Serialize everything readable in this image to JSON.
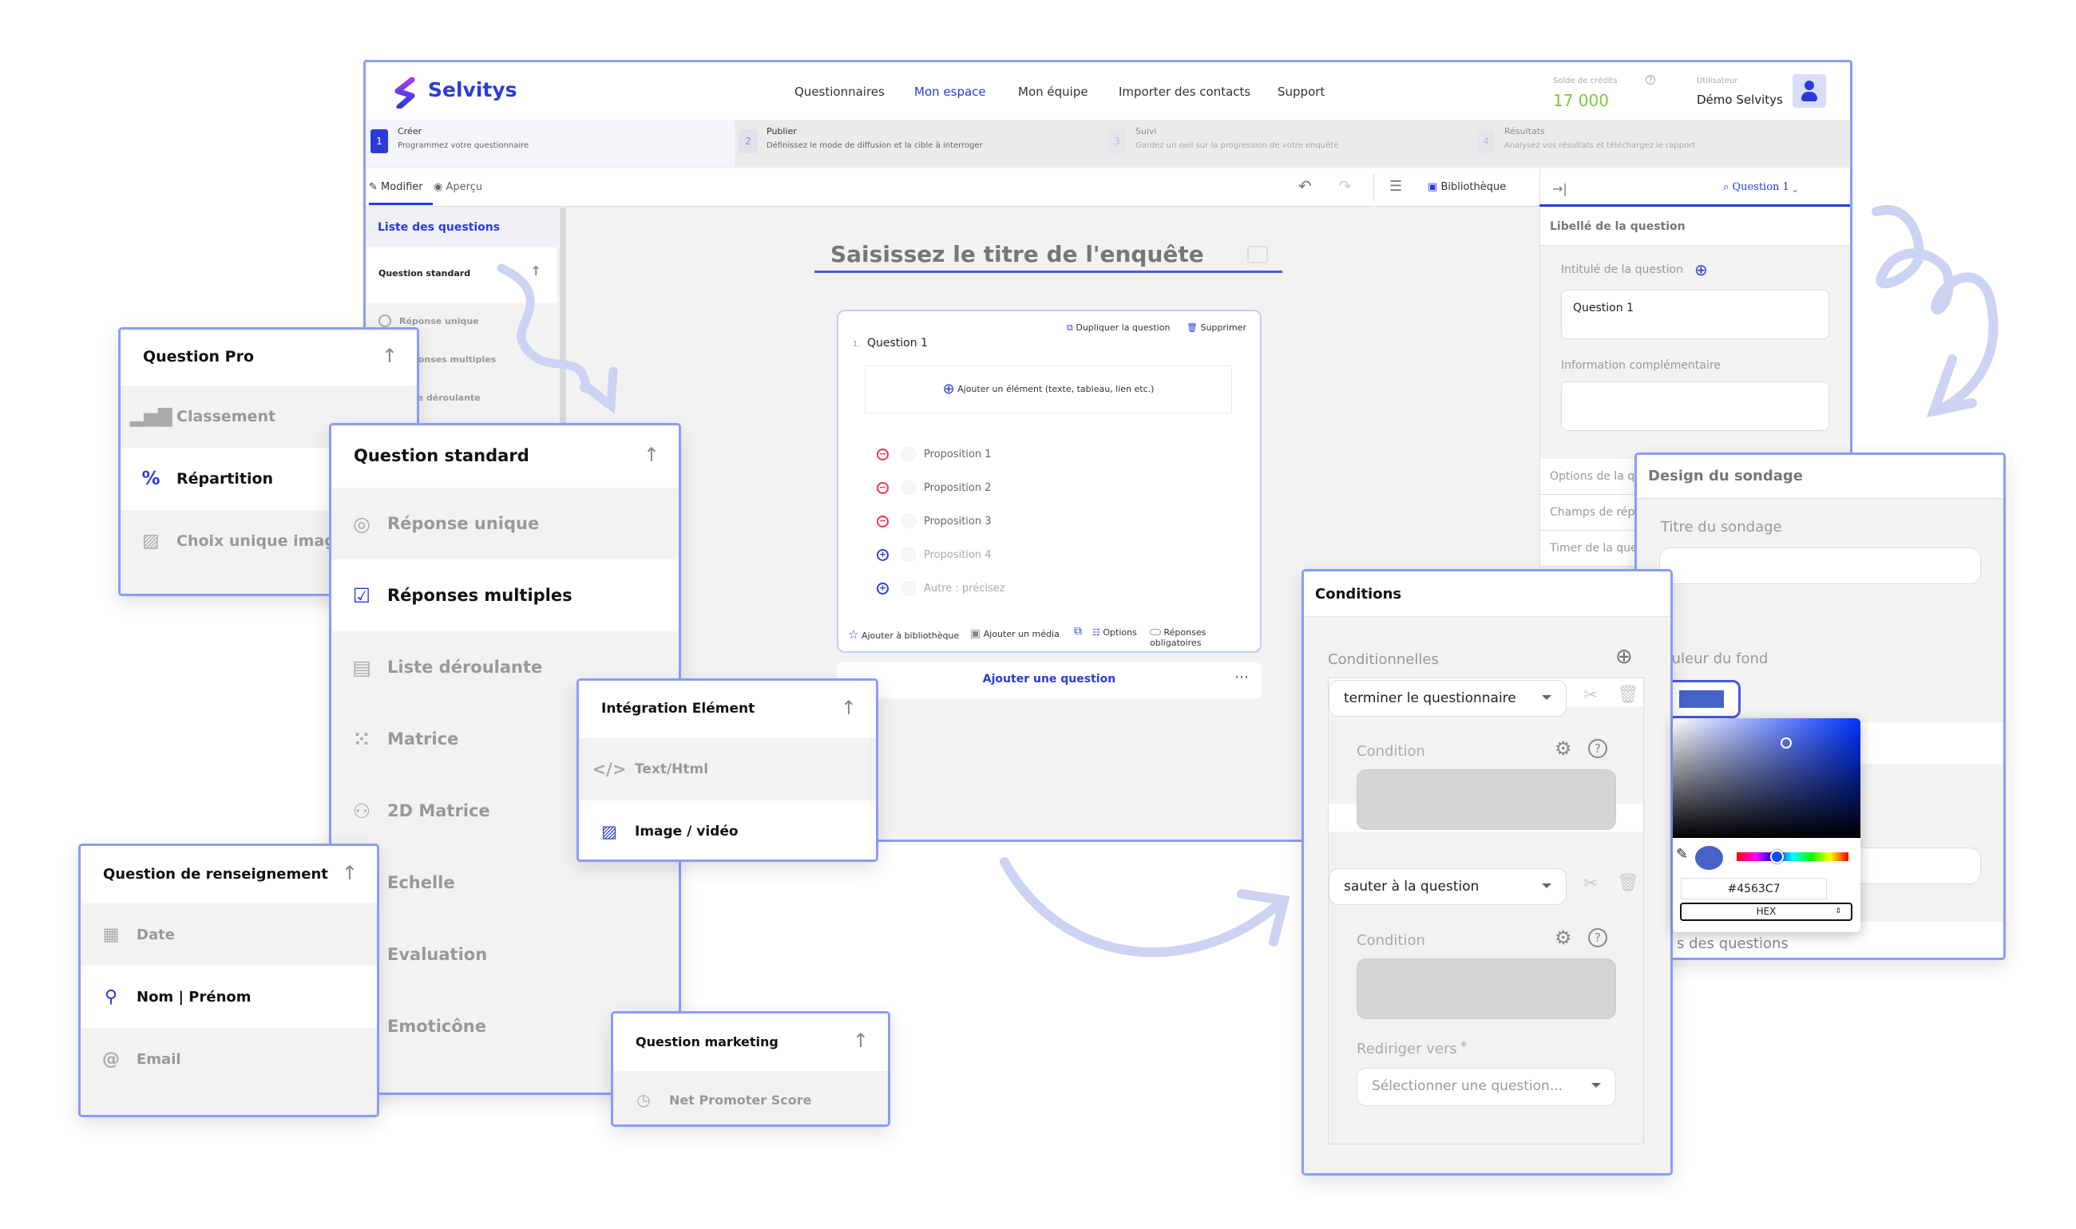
{
  "header": {
    "brand": "Selvitys",
    "nav": [
      "Questionnaires",
      "Mon espace",
      "Mon équipe",
      "Importer des contacts",
      "Support"
    ],
    "active_nav": "Mon espace",
    "credits_label": "Solde de crédits",
    "credits_value": "17 000",
    "user_label": "Utilisateur",
    "user_name": "Démo Selvitys"
  },
  "steps": [
    {
      "num": "1",
      "title": "Créer",
      "desc": "Programmez votre questionnaire"
    },
    {
      "num": "2",
      "title": "Publier",
      "desc": "Définissez le mode de diffusion et la cible à interroger"
    },
    {
      "num": "3",
      "title": "Suivi",
      "desc": "Gardez un oeil sur la progression de votre enquête"
    },
    {
      "num": "4",
      "title": "Résultats",
      "desc": "Analysez vos résultats et téléchargez le rapport"
    }
  ],
  "toolbar": {
    "modifier": "Modifier",
    "apercu": "Aperçu",
    "bibliotheque": "Bibliothèque",
    "question_selector": "Question 1"
  },
  "sidebar": {
    "title": "Liste des questions",
    "group": "Question standard",
    "items": [
      "Réponse unique",
      "Réponses multiples",
      "Liste déroulante",
      "Matrice"
    ]
  },
  "editor": {
    "title_placeholder": "Saisissez le titre de l'enquête",
    "question": {
      "number": "1.",
      "title": "Question 1",
      "duplicate": "Dupliquer la question",
      "delete": "Supprimer",
      "add_element": "Ajouter un élément (texte, tableau, lien etc.)",
      "propositions": [
        {
          "label": "Proposition 1",
          "action": "remove"
        },
        {
          "label": "Proposition 2",
          "action": "remove"
        },
        {
          "label": "Proposition 3",
          "action": "remove"
        },
        {
          "label": "Proposition 4",
          "action": "add"
        },
        {
          "label": "Autre : précisez",
          "action": "add"
        }
      ],
      "footer": {
        "library": "Ajouter à bibliothèque",
        "media": "Ajouter un média",
        "options": "Options",
        "required": "Réponses obligatoires"
      }
    },
    "add_question": "Ajouter une question"
  },
  "right_panel": {
    "section": "Libellé de la question",
    "intitule_label": "Intitulé de la question",
    "intitule_value": "Question 1",
    "info_label": "Information complémentaire",
    "rows": [
      "Options de la q",
      "Champs de rép",
      "Timer de la que"
    ]
  },
  "panels": {
    "question_pro": {
      "title": "Question Pro",
      "items": [
        {
          "label": "Classement",
          "icon": "bar-chart-icon",
          "active": false
        },
        {
          "label": "Répartition",
          "icon": "percent-icon",
          "active": true
        },
        {
          "label": "Choix unique image",
          "icon": "image-icon",
          "active": false
        }
      ]
    },
    "question_standard": {
      "title": "Question standard",
      "items": [
        {
          "label": "Réponse unique",
          "icon": "radio-icon",
          "active": false
        },
        {
          "label": "Réponses multiples",
          "icon": "checkbox-icon",
          "active": true
        },
        {
          "label": "Liste déroulante",
          "icon": "list-icon",
          "active": false
        },
        {
          "label": "Matrice",
          "icon": "grid-dots-icon",
          "active": false
        },
        {
          "label": "2D Matrice",
          "icon": "matrix-2d-icon",
          "active": false
        },
        {
          "label": "Echelle",
          "icon": "",
          "active": false
        },
        {
          "label": "Evaluation",
          "icon": "",
          "active": false
        },
        {
          "label": "Emoticône",
          "icon": "",
          "active": false
        }
      ]
    },
    "integration": {
      "title": "Intégration Elément",
      "items": [
        {
          "label": "Text/Html",
          "icon": "code-icon",
          "active": false
        },
        {
          "label": "Image / vidéo",
          "icon": "image-icon",
          "active": true
        }
      ]
    },
    "renseignement": {
      "title": "Question de renseignement",
      "items": [
        {
          "label": "Date",
          "icon": "calendar-icon",
          "active": false
        },
        {
          "label": "Nom | Prénom",
          "icon": "badge-icon",
          "active": true
        },
        {
          "label": "Email",
          "icon": "at-icon",
          "active": false
        }
      ]
    },
    "marketing": {
      "title": "Question marketing",
      "items": [
        {
          "label": "Net Promoter Score",
          "icon": "gauge-icon",
          "active": false
        }
      ]
    }
  },
  "conditions": {
    "title": "Conditions",
    "conditionnelles": "Conditionnelles",
    "blocks": [
      {
        "action": "terminer le questionnaire",
        "condition_label": "Condition"
      },
      {
        "action": "sauter à la question",
        "condition_label": "Condition"
      }
    ],
    "redirect_label": "Rediriger vers",
    "required_mark": "*",
    "redirect_placeholder": "Sélectionner une question..."
  },
  "design": {
    "title": "Design du sondage",
    "titre_label": "Titre du sondage",
    "couleur_label": "Couleur du fond",
    "partial_text": "s des questions"
  },
  "color_picker": {
    "hex": "#4563C7",
    "mode": "HEX",
    "hue_position": 0.36
  },
  "colors": {
    "brand": "#2a3bd8",
    "panel_border": "#8b9cf7",
    "credits": "#7ac943",
    "background_color": "#4563C7",
    "remove": "#e23a57",
    "decor": "#ccd3f3"
  }
}
